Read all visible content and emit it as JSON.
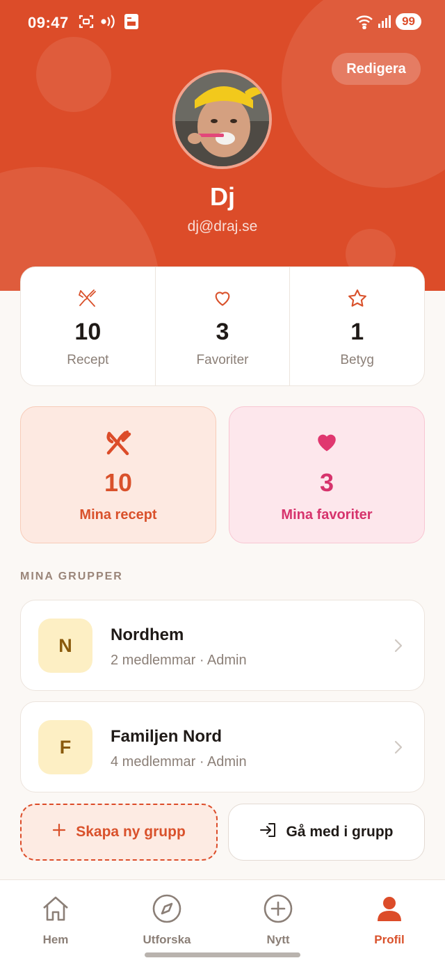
{
  "status_bar": {
    "time": "09:47",
    "battery": "99"
  },
  "profile": {
    "edit_label": "Redigera",
    "name": "Dj",
    "email": "dj@draj.se"
  },
  "stats": [
    {
      "icon": "utensils-icon",
      "value": "10",
      "label": "Recept"
    },
    {
      "icon": "heart-outline-icon",
      "value": "3",
      "label": "Favoriter"
    },
    {
      "icon": "star-outline-icon",
      "value": "1",
      "label": "Betyg"
    }
  ],
  "cards": {
    "recipes": {
      "icon": "utensils-icon",
      "value": "10",
      "label": "Mina recept"
    },
    "favorites": {
      "icon": "heart-icon",
      "value": "3",
      "label": "Mina favoriter"
    }
  },
  "groups_title": "MINA GRUPPER",
  "groups": [
    {
      "initial": "N",
      "name": "Nordhem",
      "meta": "2 medlemmar · Admin"
    },
    {
      "initial": "F",
      "name": "Familjen Nord",
      "meta": "4 medlemmar · Admin"
    }
  ],
  "actions": {
    "create_group": "Skapa ny grupp",
    "join_group": "Gå med i grupp"
  },
  "nav": [
    {
      "label": "Hem",
      "icon": "home-icon",
      "active": false
    },
    {
      "label": "Utforska",
      "icon": "compass-icon",
      "active": false
    },
    {
      "label": "Nytt",
      "icon": "plus-circle-icon",
      "active": false
    },
    {
      "label": "Profil",
      "icon": "user-icon",
      "active": true
    }
  ],
  "colors": {
    "accent": "#dc4c29",
    "favorite": "#d6336c",
    "background": "#fbf8f5"
  }
}
